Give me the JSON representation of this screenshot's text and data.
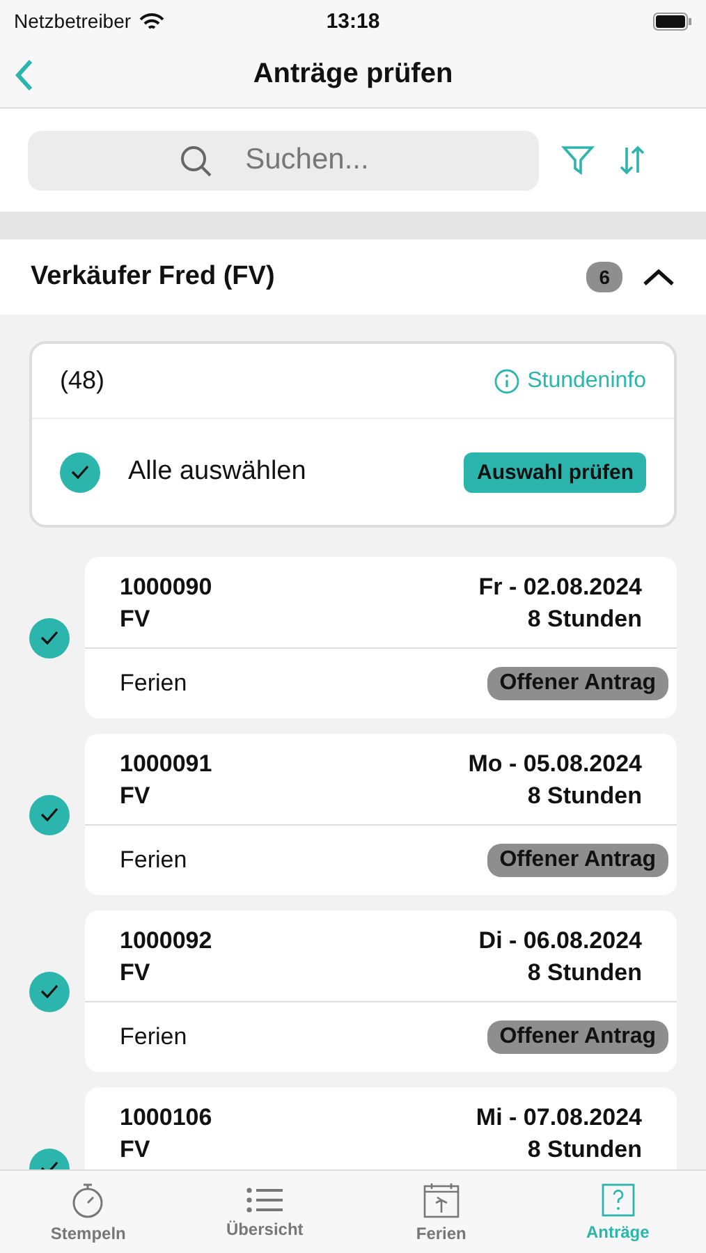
{
  "status_bar": {
    "carrier": "Netzbetreiber",
    "time": "13:18"
  },
  "nav": {
    "title": "Anträge prüfen"
  },
  "search": {
    "placeholder": "Suchen..."
  },
  "group": {
    "name": "Verkäufer Fred (FV)",
    "count": "6",
    "expanded": true
  },
  "summary": {
    "total": "(48)",
    "info_link": "Stundeninfo",
    "select_all": {
      "label": "Alle auswählen",
      "checked": true
    },
    "action": "Auswahl prüfen"
  },
  "requests": [
    {
      "id": "1000090",
      "code": "FV",
      "date": "Fr - 02.08.2024",
      "hours": "8 Stunden",
      "type": "Ferien",
      "status": "Offener Antrag",
      "checked": true
    },
    {
      "id": "1000091",
      "code": "FV",
      "date": "Mo - 05.08.2024",
      "hours": "8 Stunden",
      "type": "Ferien",
      "status": "Offener Antrag",
      "checked": true
    },
    {
      "id": "1000092",
      "code": "FV",
      "date": "Di - 06.08.2024",
      "hours": "8 Stunden",
      "type": "Ferien",
      "status": "Offener Antrag",
      "checked": true
    },
    {
      "id": "1000106",
      "code": "FV",
      "date": "Mi - 07.08.2024",
      "hours": "8 Stunden",
      "checked": true
    }
  ],
  "tab_bar": [
    {
      "label": "Stempeln",
      "kind": "stopwatch",
      "selected": false
    },
    {
      "label": "Übersicht",
      "kind": "list",
      "selected": false
    },
    {
      "label": "Ferien",
      "kind": "calendar",
      "selected": false
    },
    {
      "label": "Anträge",
      "kind": "question",
      "selected": true
    }
  ]
}
